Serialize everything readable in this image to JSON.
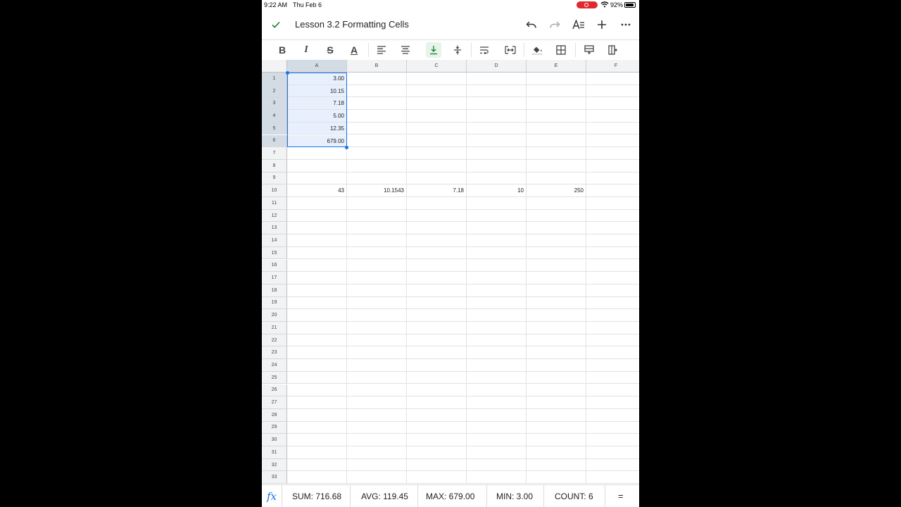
{
  "status_bar": {
    "time": "9:22 AM",
    "date": "Thu Feb 6",
    "battery": "92%"
  },
  "titlebar": {
    "title": "Lesson 3.2 Formatting Cells"
  },
  "icons": {
    "done": "check-icon",
    "undo": "undo-icon",
    "redo": "redo-icon",
    "text_format": "text-format-icon",
    "add": "plus-icon",
    "more": "more-icon",
    "bold": "bold-icon",
    "italic": "italic-icon",
    "strikethrough": "strikethrough-icon",
    "text_color": "text-color-icon",
    "align_left": "align-left-icon",
    "align_center": "align-center-icon",
    "valign_bottom": "vertical-align-bottom-icon",
    "valign_middle": "vertical-align-middle-icon",
    "wrap": "text-wrap-icon",
    "merge": "merge-cells-icon",
    "fill": "fill-color-icon",
    "borders": "borders-icon",
    "insert_row": "insert-row-icon",
    "insert_col": "insert-column-icon"
  },
  "toolbar": {
    "bold_label": "B",
    "italic_label": "I",
    "strike_label": "S",
    "text_color_label": "A"
  },
  "columns": [
    "A",
    "B",
    "C",
    "D",
    "E",
    "F"
  ],
  "rows": [
    "1",
    "2",
    "3",
    "4",
    "5",
    "6",
    "7",
    "8",
    "9",
    "10",
    "11",
    "12",
    "13",
    "14",
    "15",
    "16",
    "17",
    "18",
    "19",
    "20",
    "21",
    "22",
    "23",
    "24",
    "25",
    "26",
    "27",
    "28",
    "29",
    "30",
    "31",
    "32",
    "33"
  ],
  "cells": {
    "A1": "3.00",
    "A2": "10.15",
    "A3": "7.18",
    "A4": "5.00",
    "A5": "12.35",
    "A6": "679.00",
    "A10": "43",
    "B10": "10.1543",
    "C10": "7.18",
    "D10": "10",
    "E10": "250"
  },
  "selection": {
    "range": "A1:A6"
  },
  "footer": {
    "fx_label": "fx",
    "sum": "SUM: 716.68",
    "avg": "AVG: 119.45",
    "max": "MAX: 679.00",
    "min": "MIN: 3.00",
    "count": "COUNT: 6",
    "more_label": "="
  },
  "colors": {
    "accent": "#1a73e8",
    "check": "#188038",
    "record": "#e0282e",
    "selection_fill": "#e8f0fe"
  }
}
